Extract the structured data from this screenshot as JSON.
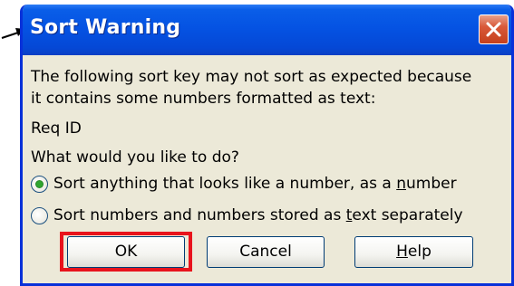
{
  "annotation": {
    "arrow_color": "#000000",
    "highlight_color": "#e8131c"
  },
  "dialog": {
    "title": "Sort Warning",
    "close_icon": "close-icon",
    "message_line1": "The following sort key may not sort as expected because",
    "message_line2": "it contains some numbers formatted as text:",
    "sort_key": "Req ID",
    "question": "What would you like to do?",
    "options": [
      {
        "pre": "Sort anything that looks like a number, as a ",
        "accel": "n",
        "post": "umber",
        "checked": true
      },
      {
        "pre": "Sort numbers and numbers stored as ",
        "accel": "t",
        "post": "ext separately",
        "checked": false
      }
    ],
    "buttons": {
      "ok": "OK",
      "cancel": "Cancel",
      "help_accel": "H",
      "help_rest": "elp"
    }
  }
}
